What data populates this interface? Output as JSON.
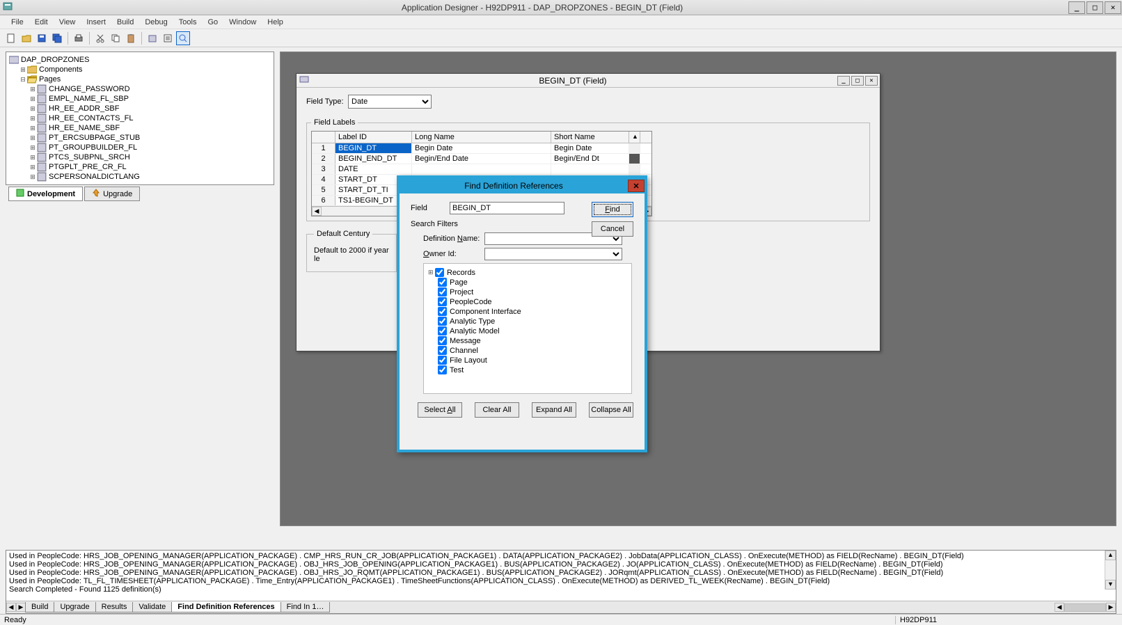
{
  "app": {
    "title": "Application Designer - H92DP911 - DAP_DROPZONES - BEGIN_DT (Field)"
  },
  "menu": [
    "File",
    "Edit",
    "View",
    "Insert",
    "Build",
    "Debug",
    "Tools",
    "Go",
    "Window",
    "Help"
  ],
  "tree": {
    "root": "DAP_DROPZONES",
    "folders": [
      {
        "label": "Components",
        "expanded": false
      },
      {
        "label": "Pages",
        "expanded": true,
        "children": [
          "CHANGE_PASSWORD",
          "EMPL_NAME_FL_SBP",
          "HR_EE_ADDR_SBF",
          "HR_EE_CONTACTS_FL",
          "HR_EE_NAME_SBF",
          "PT_ERCSUBPAGE_STUB",
          "PT_GROUPBUILDER_FL",
          "PTCS_SUBPNL_SRCH",
          "PTGPLT_PRE_CR_FL",
          "SCPERSONALDICTLANG"
        ]
      }
    ],
    "tabs": {
      "dev": "Development",
      "upg": "Upgrade"
    }
  },
  "field_window": {
    "title": "BEGIN_DT (Field)",
    "field_type_label": "Field Type:",
    "field_type_value": "Date",
    "labels_legend": "Field Labels",
    "columns": {
      "idx": "",
      "labelid": "Label ID",
      "long": "Long Name",
      "short": "Short Name"
    },
    "rows": [
      {
        "idx": "1",
        "labelid": "BEGIN_DT",
        "long": "Begin Date",
        "short": "Begin Date",
        "selected": true
      },
      {
        "idx": "2",
        "labelid": "BEGIN_END_DT",
        "long": "Begin/End Date",
        "short": "Begin/End Dt"
      },
      {
        "idx": "3",
        "labelid": "DATE",
        "long": "",
        "short": ""
      },
      {
        "idx": "4",
        "labelid": "START_DT",
        "long": "",
        "short": ""
      },
      {
        "idx": "5",
        "labelid": "START_DT_TI",
        "long": "",
        "short": ""
      },
      {
        "idx": "6",
        "labelid": "TS1-BEGIN_DT",
        "long": "",
        "short": ""
      }
    ],
    "century_legend": "Default Century",
    "century_text": "Default to 2000 if year le"
  },
  "dialog": {
    "title": "Find Definition References",
    "field_label": "Field",
    "field_value": "BEGIN_DT",
    "find": "Find",
    "cancel": "Cancel",
    "filters_label": "Search Filters",
    "defname_label": "Definition Name:",
    "defname_underline_pos": "N",
    "owner_label": "Owner Id:",
    "owner_underline_pos": "O",
    "checks": [
      "Records",
      "Page",
      "Project",
      "PeopleCode",
      "Component Interface",
      "Analytic Type",
      "Analytic Model",
      "Message",
      "Channel",
      "File Layout",
      "Test"
    ],
    "select_all": "Select All",
    "clear_all": "Clear All",
    "expand_all": "Expand All",
    "collapse_all": "Collapse All"
  },
  "output": {
    "lines": [
      "Used in PeopleCode: HRS_JOB_OPENING_MANAGER(APPLICATION_PACKAGE) . CMP_HRS_RUN_CR_JOB(APPLICATION_PACKAGE1) . DATA(APPLICATION_PACKAGE2) . JobData(APPLICATION_CLASS) . OnExecute(METHOD) as FIELD(RecName) . BEGIN_DT(Field)",
      "Used in PeopleCode: HRS_JOB_OPENING_MANAGER(APPLICATION_PACKAGE) . OBJ_HRS_JOB_OPENING(APPLICATION_PACKAGE1) . BUS(APPLICATION_PACKAGE2) . JO(APPLICATION_CLASS) . OnExecute(METHOD) as FIELD(RecName) . BEGIN_DT(Field)",
      "Used in PeopleCode: HRS_JOB_OPENING_MANAGER(APPLICATION_PACKAGE) . OBJ_HRS_JO_RQMT(APPLICATION_PACKAGE1) . BUS(APPLICATION_PACKAGE2) . JORqmt(APPLICATION_CLASS) . OnExecute(METHOD) as FIELD(RecName) . BEGIN_DT(Field)",
      "Used in PeopleCode: TL_FL_TIMESHEET(APPLICATION_PACKAGE) . Time_Entry(APPLICATION_PACKAGE1) . TimeSheetFunctions(APPLICATION_CLASS) . OnExecute(METHOD) as DERIVED_TL_WEEK(RecName) . BEGIN_DT(Field)",
      "Search Completed - Found 1125 definition(s)"
    ],
    "tabs": [
      "Build",
      "Upgrade",
      "Results",
      "Validate",
      "Find Definition References",
      "Find In 1…"
    ],
    "active_tab": "Find Definition References"
  },
  "status": {
    "ready": "Ready",
    "db": "H92DP911"
  }
}
